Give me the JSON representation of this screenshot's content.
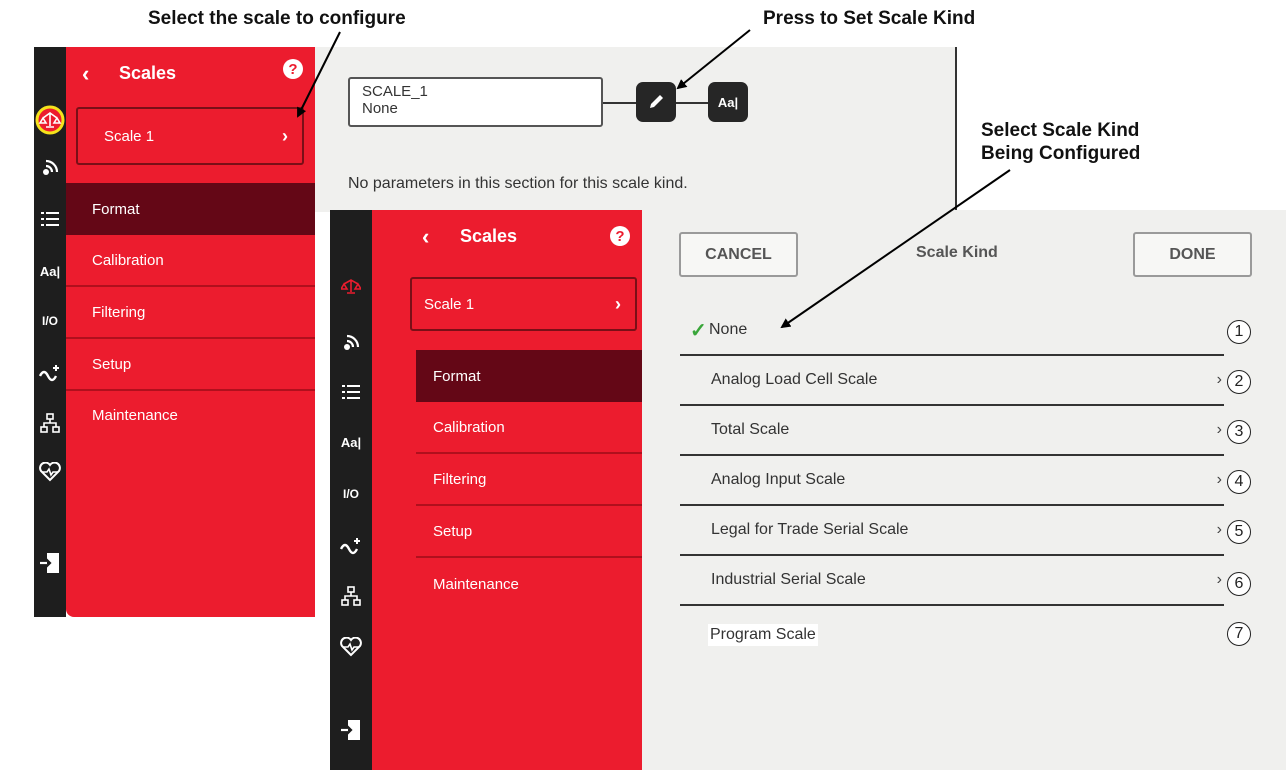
{
  "callouts": {
    "select_scale": "Select the scale to configure",
    "press_set_kind": "Press to Set Scale Kind",
    "select_kind_line1": "Select Scale Kind",
    "select_kind_line2": "Being Configured"
  },
  "back_panel": {
    "sidebar": {
      "back_symbol": "‹",
      "title": "Scales",
      "help_symbol": "?",
      "scale_button": {
        "label": "Scale 1",
        "chevron": "›"
      },
      "items": [
        {
          "label": "Format",
          "active": true
        },
        {
          "label": "Calibration"
        },
        {
          "label": "Filtering"
        },
        {
          "label": "Setup"
        },
        {
          "label": "Maintenance"
        }
      ]
    },
    "main": {
      "scale_name": "SCALE_1",
      "scale_kind": "None",
      "edit_icon": "pencil-icon",
      "alias_button_label": "Aa|",
      "message": "No parameters in this section for this scale kind."
    }
  },
  "rail_icons": [
    "scale-balance-icon",
    "wireless-icon",
    "list-icon",
    "text-aa-icon",
    "io-icon",
    "flow-icon",
    "network-icon",
    "heart-monitor-icon",
    "exit-icon"
  ],
  "front_panel": {
    "sidebar": {
      "back_symbol": "‹",
      "title": "Scales",
      "help_symbol": "?",
      "scale_button": {
        "label": "Scale 1",
        "chevron": "›"
      },
      "items": [
        {
          "label": "Format",
          "active": true
        },
        {
          "label": "Calibration"
        },
        {
          "label": "Filtering"
        },
        {
          "label": "Setup"
        },
        {
          "label": "Maintenance"
        }
      ]
    },
    "dialog": {
      "cancel_label": "CANCEL",
      "title": "Scale Kind",
      "done_label": "DONE",
      "checkmark": "✓",
      "kinds": [
        {
          "label": "None",
          "number": "1",
          "selected": true,
          "chevron": ""
        },
        {
          "label": "Analog Load Cell Scale",
          "number": "2",
          "chevron": "›"
        },
        {
          "label": "Total Scale",
          "number": "3",
          "chevron": "›"
        },
        {
          "label": "Analog Input Scale",
          "number": "4",
          "chevron": "›"
        },
        {
          "label": "Legal for Trade Serial Scale",
          "number": "5",
          "chevron": "›"
        },
        {
          "label": "Industrial Serial Scale",
          "number": "6",
          "chevron": "›"
        },
        {
          "label": "Program Scale",
          "number": "7",
          "chevron": ""
        }
      ]
    }
  },
  "colors": {
    "brand_red": "#ec1c2e",
    "active_item": "#640716",
    "rail_dark": "#1e1e1e",
    "highlight_ring": "#f5e21b",
    "check_green": "#3aa63a"
  }
}
